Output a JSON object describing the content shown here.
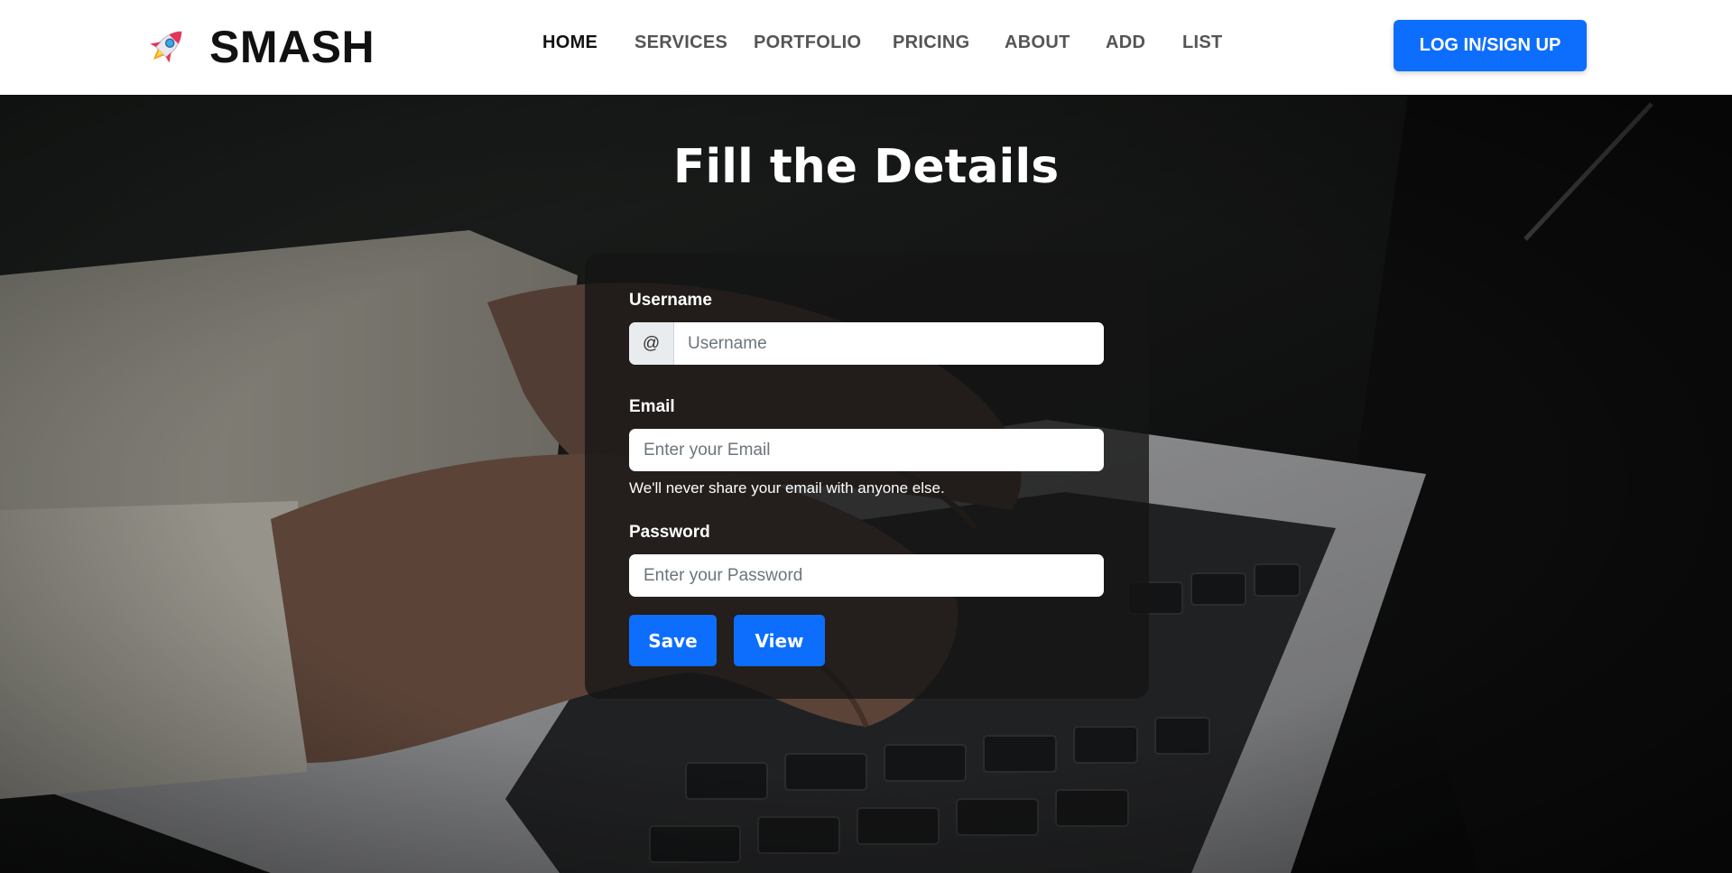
{
  "brand": {
    "name": "SMASH",
    "logo_icon": "rocket-icon"
  },
  "nav": {
    "items": [
      {
        "label": "HOME",
        "active": true
      },
      {
        "label": "SERVICES"
      },
      {
        "label": "PORTFOLIO"
      },
      {
        "label": "PRICING"
      },
      {
        "label": "ABOUT"
      },
      {
        "label": "ADD"
      },
      {
        "label": "LIST"
      }
    ],
    "login_label": "LOG IN/SIGN UP"
  },
  "hero": {
    "title": "Fill the Details"
  },
  "form": {
    "username": {
      "label": "Username",
      "prefix": "@",
      "placeholder": "Username"
    },
    "email": {
      "label": "Email",
      "placeholder": "Enter your Email",
      "help": "We'll never share your email with anyone else."
    },
    "password": {
      "label": "Password",
      "placeholder": "Enter your Password"
    },
    "save_label": "Save",
    "view_label": "View"
  },
  "colors": {
    "primary": "#0d6efd",
    "navbar_bg": "#ffffff",
    "card_bg": "rgba(20,20,20,0.78)"
  }
}
